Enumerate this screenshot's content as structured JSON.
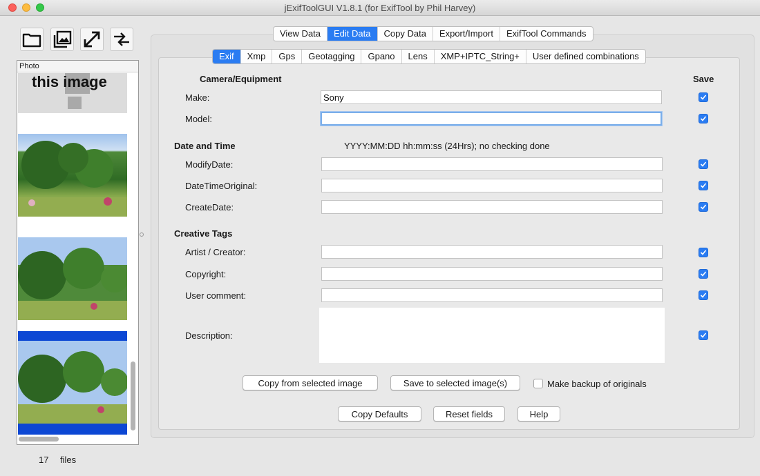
{
  "window": {
    "title": "jExifToolGUI V1.8.1  (for ExifTool by Phil Harvey)"
  },
  "toolbar": {
    "icons": [
      "folder-icon",
      "image-gallery-icon",
      "expand-arrows-icon",
      "compare-arrows-icon"
    ]
  },
  "thumbnails": {
    "header": "Photo",
    "placeholder_text": "this image",
    "count": 17,
    "count_label": "files"
  },
  "main_tabs": [
    {
      "label": "View Data",
      "active": false
    },
    {
      "label": "Edit Data",
      "active": true
    },
    {
      "label": "Copy Data",
      "active": false
    },
    {
      "label": "Export/Import",
      "active": false
    },
    {
      "label": "ExifTool Commands",
      "active": false
    }
  ],
  "sub_tabs": [
    {
      "label": "Exif",
      "active": true
    },
    {
      "label": "Xmp",
      "active": false
    },
    {
      "label": "Gps",
      "active": false
    },
    {
      "label": "Geotagging",
      "active": false
    },
    {
      "label": "Gpano",
      "active": false
    },
    {
      "label": "Lens",
      "active": false
    },
    {
      "label": "XMP+IPTC_String+",
      "active": false
    },
    {
      "label": "User defined combinations",
      "active": false
    }
  ],
  "form": {
    "save_header": "Save",
    "camera_section": "Camera/Equipment",
    "make_label": "Make:",
    "make_value": "Sony",
    "model_label": "Model:",
    "model_value": "",
    "datetime_section": "Date and Time",
    "datetime_hint": "YYYY:MM:DD hh:mm:ss (24Hrs); no checking done",
    "modifydate_label": "ModifyDate:",
    "modifydate_value": "",
    "datetimeoriginal_label": "DateTimeOriginal:",
    "datetimeoriginal_value": "",
    "createdate_label": "CreateDate:",
    "createdate_value": "",
    "creative_section": "Creative Tags",
    "artist_label": "Artist / Creator:",
    "artist_value": "",
    "copyright_label": "Copyright:",
    "copyright_value": "",
    "usercomment_label": "User comment:",
    "usercomment_value": "",
    "description_label": "Description:",
    "description_value": ""
  },
  "actions": {
    "copy_from_selected": "Copy from selected image",
    "save_to_selected": "Save to selected image(s)",
    "make_backup": "Make backup of originals",
    "copy_defaults": "Copy Defaults",
    "reset_fields": "Reset fields",
    "help": "Help"
  },
  "colors": {
    "accent": "#2a7cf2",
    "panel": "#e1e1e1"
  }
}
